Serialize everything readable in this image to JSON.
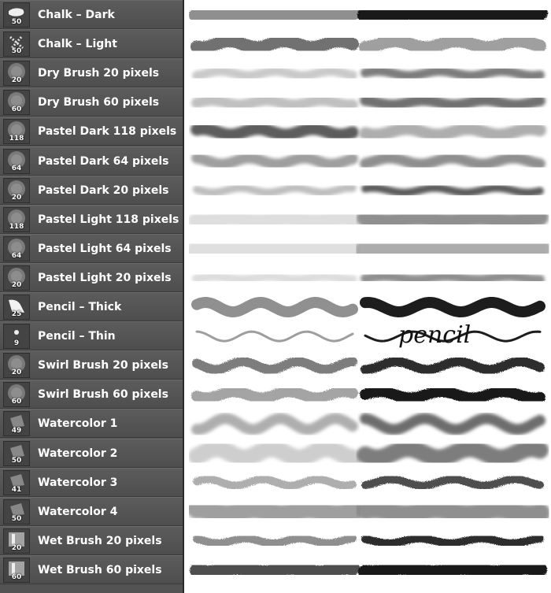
{
  "brushes": [
    {
      "name": "Chalk – Dark",
      "size": "50",
      "icon": "chalk-dark-icon"
    },
    {
      "name": "Chalk – Light",
      "size": "50",
      "icon": "chalk-light-icon"
    },
    {
      "name": "Dry Brush 20 pixels",
      "size": "20",
      "icon": "dry-brush-icon"
    },
    {
      "name": "Dry Brush 60 pixels",
      "size": "60",
      "icon": "dry-brush-icon"
    },
    {
      "name": "Pastel Dark 118 pixels",
      "size": "118",
      "icon": "pastel-icon"
    },
    {
      "name": "Pastel Dark 64 pixels",
      "size": "64",
      "icon": "pastel-icon"
    },
    {
      "name": "Pastel Dark 20 pixels",
      "size": "20",
      "icon": "pastel-icon"
    },
    {
      "name": "Pastel Light 118 pixels",
      "size": "118",
      "icon": "pastel-icon"
    },
    {
      "name": "Pastel Light 64 pixels",
      "size": "64",
      "icon": "pastel-icon"
    },
    {
      "name": "Pastel Light 20 pixels",
      "size": "20",
      "icon": "pastel-icon"
    },
    {
      "name": "Pencil – Thick",
      "size": "25",
      "icon": "pencil-thick-icon"
    },
    {
      "name": "Pencil – Thin",
      "size": "9",
      "icon": "pencil-thin-icon"
    },
    {
      "name": "Swirl Brush 20 pixels",
      "size": "20",
      "icon": "swirl-brush-icon"
    },
    {
      "name": "Swirl Brush 60 pixels",
      "size": "60",
      "icon": "swirl-brush-icon"
    },
    {
      "name": "Watercolor 1",
      "size": "49",
      "icon": "watercolor-icon"
    },
    {
      "name": "Watercolor 2",
      "size": "50",
      "icon": "watercolor-icon"
    },
    {
      "name": "Watercolor 3",
      "size": "41",
      "icon": "watercolor-icon"
    },
    {
      "name": "Watercolor 4",
      "size": "50",
      "icon": "watercolor-icon"
    },
    {
      "name": "Wet Brush 20 pixels",
      "size": "20",
      "icon": "wet-brush-icon"
    },
    {
      "name": "Wet Brush 60 pixels",
      "size": "60",
      "icon": "wet-brush-icon"
    }
  ],
  "stroke_preview": {
    "handwriting_text": "pencil"
  },
  "colors": {
    "panel_bg": "#535353",
    "label_text": "#ffffff",
    "stroke_dark": "#111111",
    "stroke_mid": "#777777",
    "stroke_light": "#bbbbbb"
  }
}
